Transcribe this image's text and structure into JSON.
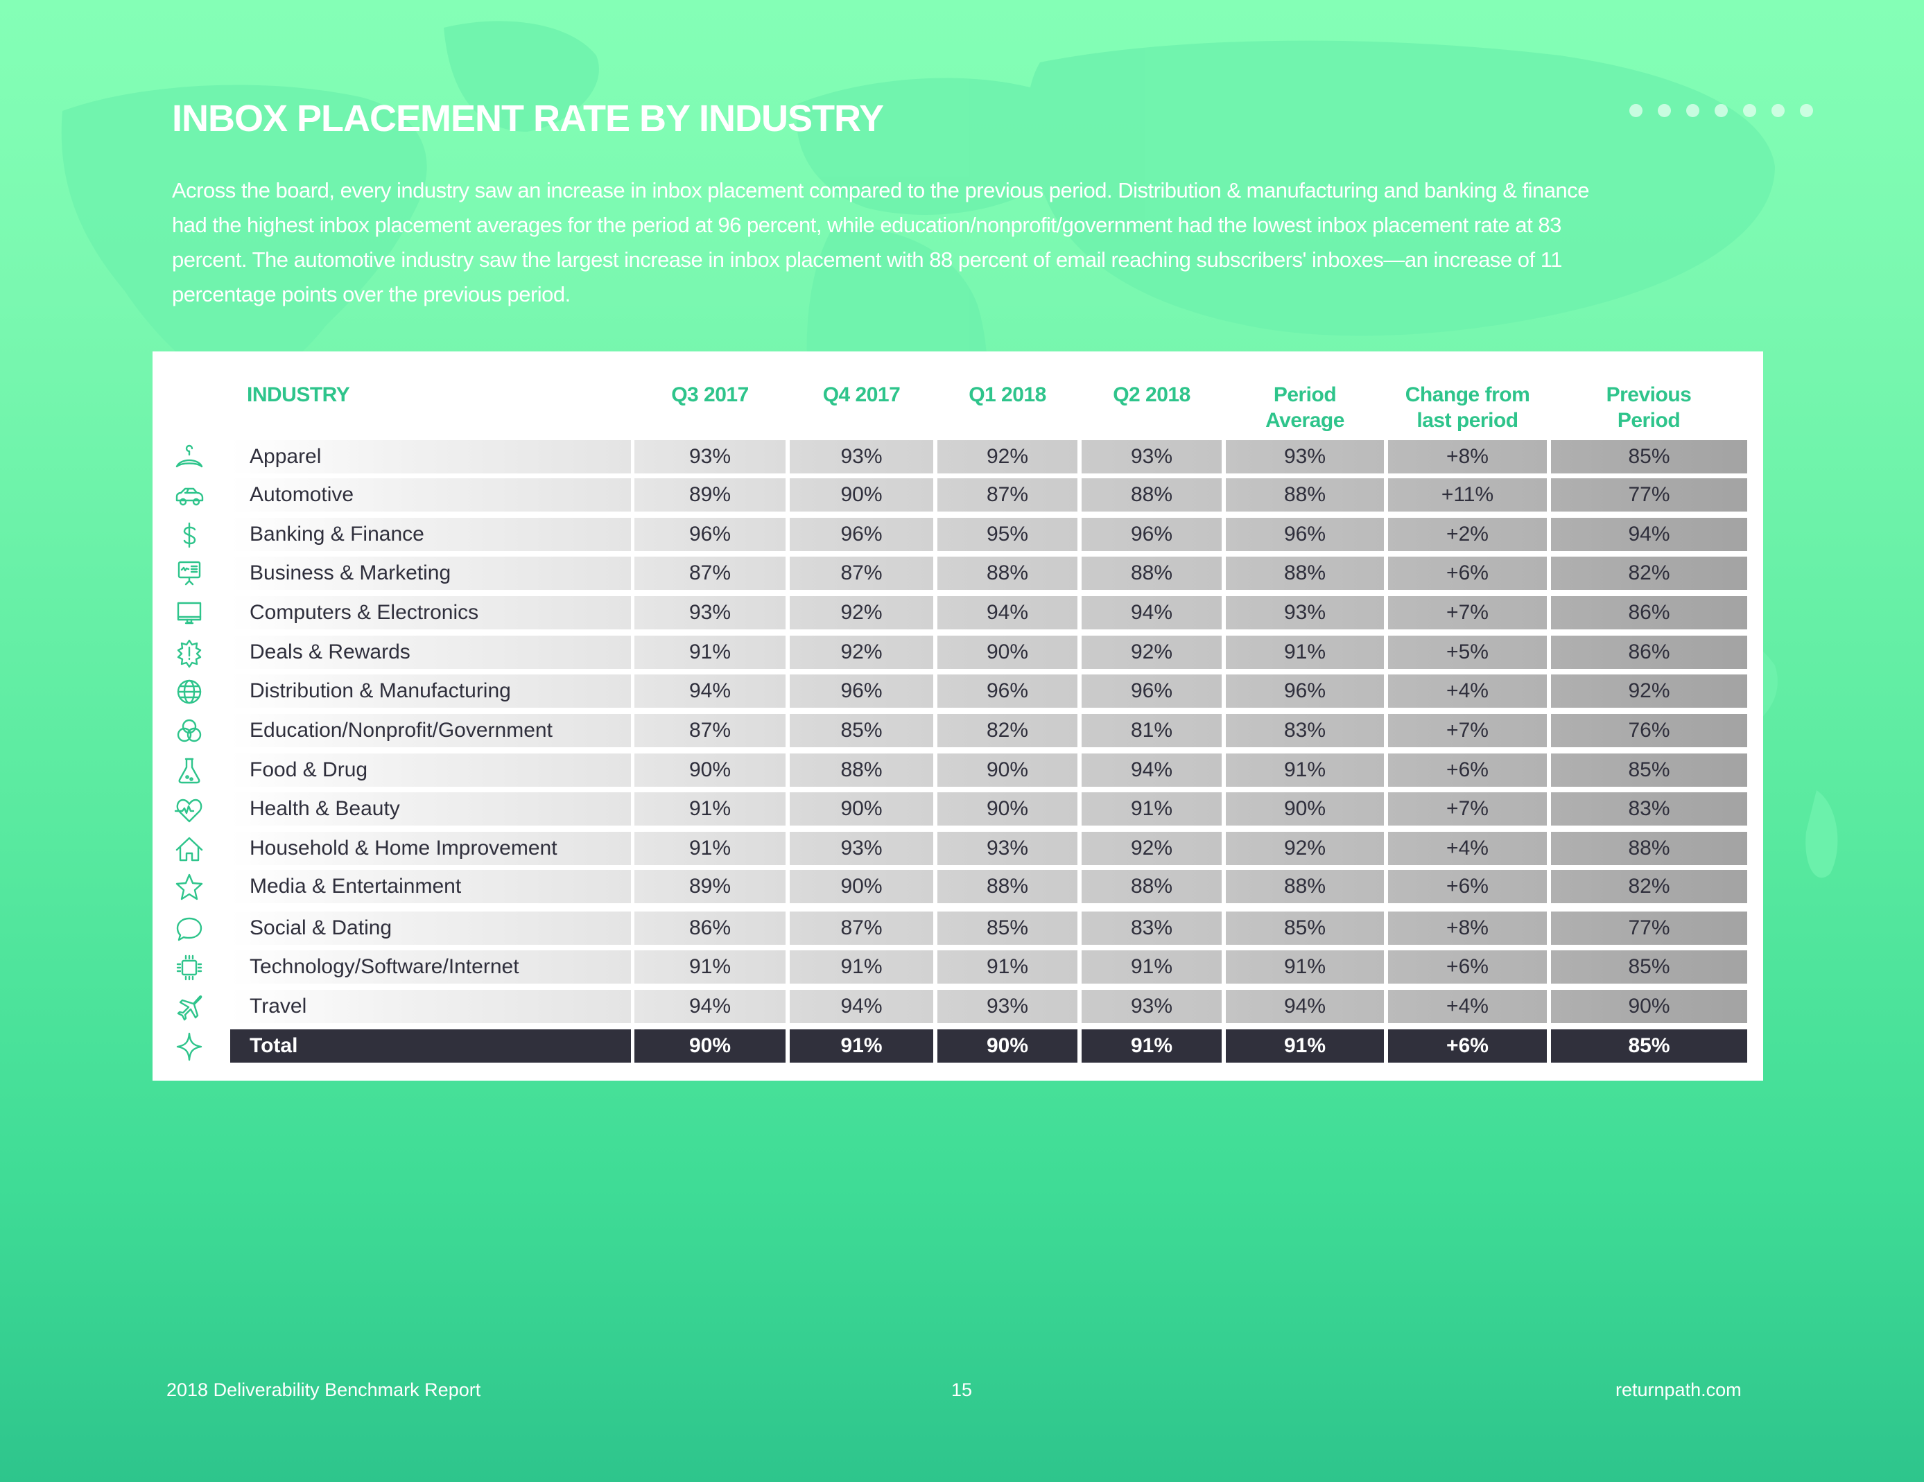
{
  "page": {
    "title": "INBOX PLACEMENT RATE BY INDUSTRY",
    "intro": "Across the board, every industry saw an increase in inbox placement compared to the previous period. Distribution & manufacturing and banking & finance had the highest inbox placement averages for the period at 96 percent, while education/nonprofit/government had the lowest inbox placement rate at 83 percent. The automotive industry saw the largest increase in inbox placement with 88 percent of email reaching subscribers' inboxes—an increase of 11 percentage points over the previous period.",
    "accent_color": "#2ec48b",
    "dots_count": 7
  },
  "table": {
    "headers": {
      "industry": "INDUSTRY",
      "columns": [
        "Q3 2017",
        "Q4 2017",
        "Q1 2018",
        "Q2 2018",
        "Period Average",
        "Change from last period",
        "Previous Period"
      ]
    },
    "rows": [
      {
        "icon": "hanger-icon",
        "industry": "Apparel",
        "values": [
          "93%",
          "93%",
          "92%",
          "93%",
          "93%",
          "+8%",
          "85%"
        ]
      },
      {
        "icon": "car-icon",
        "industry": "Automotive",
        "values": [
          "89%",
          "90%",
          "87%",
          "88%",
          "88%",
          "+11%",
          "77%"
        ]
      },
      {
        "icon": "dollar-icon",
        "industry": "Banking & Finance",
        "values": [
          "96%",
          "96%",
          "95%",
          "96%",
          "96%",
          "+2%",
          "94%"
        ]
      },
      {
        "icon": "presentation-board-icon",
        "industry": "Business & Marketing",
        "values": [
          "87%",
          "87%",
          "88%",
          "88%",
          "88%",
          "+6%",
          "82%"
        ]
      },
      {
        "icon": "monitor-icon",
        "industry": "Computers & Electronics",
        "values": [
          "93%",
          "92%",
          "94%",
          "94%",
          "93%",
          "+7%",
          "86%"
        ]
      },
      {
        "icon": "alert-badge-icon",
        "industry": "Deals & Rewards",
        "values": [
          "91%",
          "92%",
          "90%",
          "92%",
          "91%",
          "+5%",
          "86%"
        ]
      },
      {
        "icon": "globe-icon",
        "industry": "Distribution & Manufacturing",
        "values": [
          "94%",
          "96%",
          "96%",
          "96%",
          "96%",
          "+4%",
          "92%"
        ]
      },
      {
        "icon": "venn-circles-icon",
        "industry": "Education/Nonprofit/Government",
        "values": [
          "87%",
          "85%",
          "82%",
          "81%",
          "83%",
          "+7%",
          "76%"
        ]
      },
      {
        "icon": "flask-icon",
        "industry": "Food & Drug",
        "values": [
          "90%",
          "88%",
          "90%",
          "94%",
          "91%",
          "+6%",
          "85%"
        ]
      },
      {
        "icon": "heart-pulse-icon",
        "industry": "Health & Beauty",
        "values": [
          "91%",
          "90%",
          "90%",
          "91%",
          "90%",
          "+7%",
          "83%"
        ]
      },
      {
        "icon": "house-icon",
        "industry": "Household & Home Improvement",
        "values": [
          "91%",
          "93%",
          "93%",
          "92%",
          "92%",
          "+4%",
          "88%"
        ]
      },
      {
        "icon": "star-icon",
        "industry": "Media & Entertainment",
        "values": [
          "89%",
          "90%",
          "88%",
          "88%",
          "88%",
          "+6%",
          "82%"
        ]
      },
      {
        "icon": "speech-bubble-icon",
        "industry": "Social & Dating",
        "values": [
          "86%",
          "87%",
          "85%",
          "83%",
          "85%",
          "+8%",
          "77%"
        ]
      },
      {
        "icon": "chip-icon",
        "industry": "Technology/Software/Internet",
        "values": [
          "91%",
          "91%",
          "91%",
          "91%",
          "91%",
          "+6%",
          "85%"
        ]
      },
      {
        "icon": "airplane-icon",
        "industry": "Travel",
        "values": [
          "94%",
          "94%",
          "93%",
          "93%",
          "94%",
          "+4%",
          "90%"
        ]
      }
    ],
    "total": {
      "icon": "sparkle-icon",
      "industry": "Total",
      "values": [
        "90%",
        "91%",
        "90%",
        "91%",
        "91%",
        "+6%",
        "85%"
      ]
    }
  },
  "footer": {
    "report_name": "2018 Deliverability Benchmark Report",
    "page_number": "15",
    "website": "returnpath.com"
  }
}
